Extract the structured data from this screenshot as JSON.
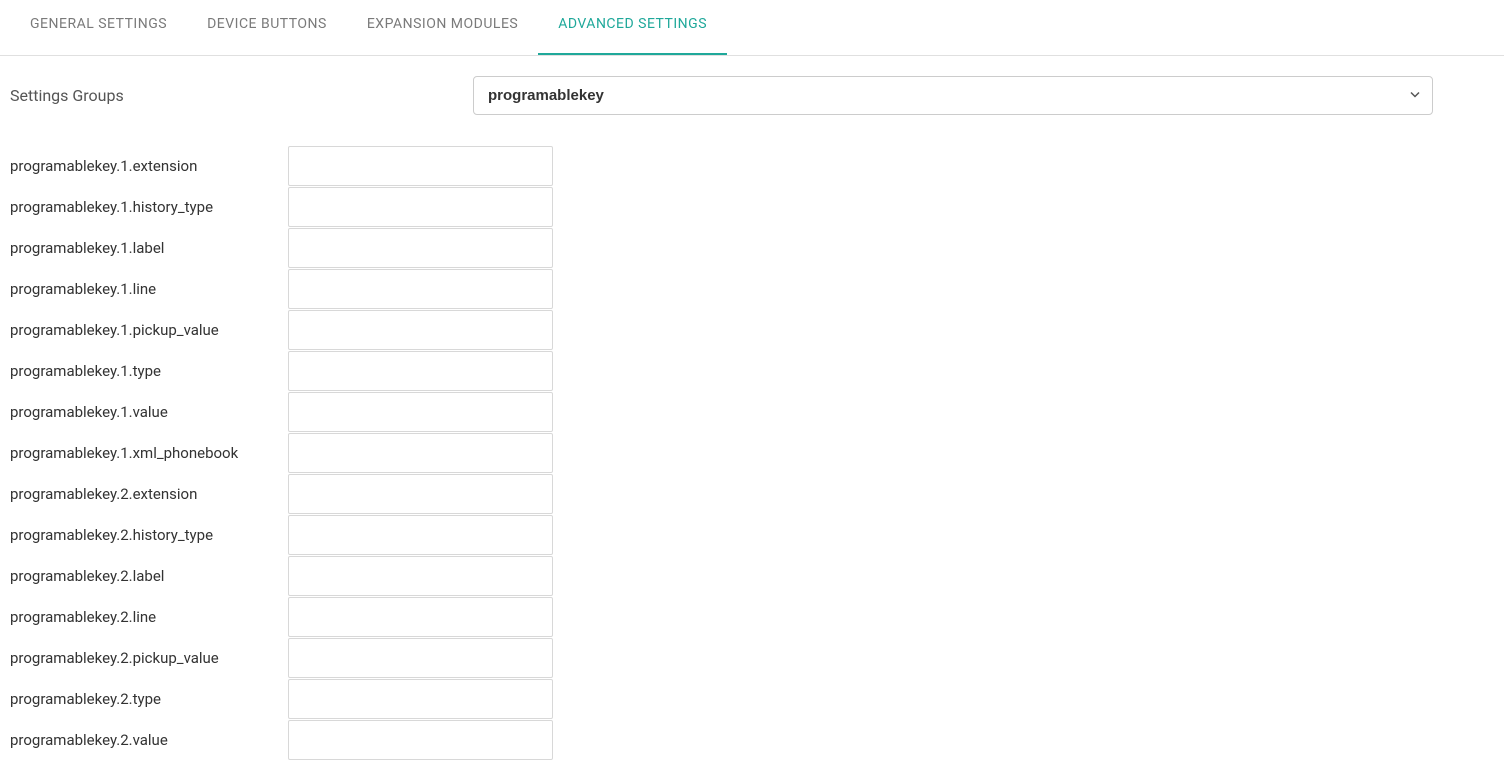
{
  "tabs": [
    {
      "label": "GENERAL SETTINGS",
      "active": false
    },
    {
      "label": "DEVICE BUTTONS",
      "active": false
    },
    {
      "label": "EXPANSION MODULES",
      "active": false
    },
    {
      "label": "ADVANCED SETTINGS",
      "active": true
    }
  ],
  "settingsGroup": {
    "label": "Settings Groups",
    "selected": "programablekey"
  },
  "settings": [
    {
      "label": "programablekey.1.extension",
      "value": ""
    },
    {
      "label": "programablekey.1.history_type",
      "value": ""
    },
    {
      "label": "programablekey.1.label",
      "value": ""
    },
    {
      "label": "programablekey.1.line",
      "value": ""
    },
    {
      "label": "programablekey.1.pickup_value",
      "value": ""
    },
    {
      "label": "programablekey.1.type",
      "value": ""
    },
    {
      "label": "programablekey.1.value",
      "value": ""
    },
    {
      "label": "programablekey.1.xml_phonebook",
      "value": ""
    },
    {
      "label": "programablekey.2.extension",
      "value": ""
    },
    {
      "label": "programablekey.2.history_type",
      "value": ""
    },
    {
      "label": "programablekey.2.label",
      "value": ""
    },
    {
      "label": "programablekey.2.line",
      "value": ""
    },
    {
      "label": "programablekey.2.pickup_value",
      "value": ""
    },
    {
      "label": "programablekey.2.type",
      "value": ""
    },
    {
      "label": "programablekey.2.value",
      "value": ""
    }
  ]
}
